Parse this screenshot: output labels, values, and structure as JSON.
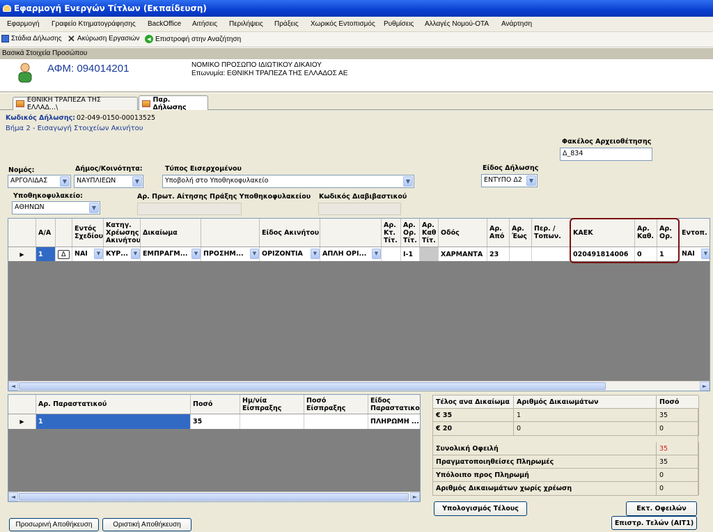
{
  "window": {
    "title": "Εφαρμογή Ενεργών Τίτλων (Εκπαίδευση)"
  },
  "menu": [
    "Εφαρμογή",
    "Γραφείο Κτηματογράφησης",
    "BackOffice",
    "Αιτήσεις",
    "Περιλήψεις",
    "Πράξεις",
    "Χωρικός Εντοπισμός",
    "Ρυθμίσεις",
    "Αλλαγές Νομού-ΟΤΑ",
    "Ανάρτηση"
  ],
  "toolbar": {
    "stages": "Στάδια Δήλωσης",
    "cancel": "Ακύρωση Εργασιών",
    "back": "Επιστροφή στην Αναζήτηση"
  },
  "section_header": "Βασικά Στοιχεία Προσώπου",
  "person": {
    "afm": "ΑΦΜ: 094014201",
    "type": "ΝΟΜΙΚΟ ΠΡΟΣΩΠΟ ΙΔΙΩΤΙΚΟΥ ΔΙΚΑΙΟΥ",
    "name": "Επωνυμία: ΕΘΝΙΚΗ ΤΡΑΠΕΖΑ ΤΗΣ ΕΛΛΑΔΟΣ ΑΕ"
  },
  "tabs": [
    "ΕΘΝΙΚΗ ΤΡΑΠΕΖΑ ΤΗΣ ΕΛΛΑΔ...\\",
    "Παρ. Δήλωσης"
  ],
  "form": {
    "code_label": "Κωδικός Δήλωσης:",
    "code_value": "02-049-0150-00013525",
    "step": "Βήμα 2 - Εισαγωγή Στοιχείων Ακινήτου",
    "folder_label": "Φακέλος Αρχειοθέτησης",
    "folder_value": "Δ_834",
    "nomos_label": "Νομός:",
    "nomos_value": "ΑΡΓΟΛΙΔΑΣ",
    "dimos_label": "Δήμος/Κοινότητα:",
    "dimos_value": "ΝΑΥΠΛΙΕΩΝ",
    "incoming_label": "Τύπος Εισερχομένου",
    "incoming_value": "Υποβολή στο Υποθηκοφυλακείο",
    "decl_type_label": "Είδος Δήλωσης",
    "decl_type_value": "ΕΝΤΥΠΟ Δ2",
    "ypoth_label": "Υποθηκοφυλακείο:",
    "ypoth_value": "ΑΘΗΝΩΝ",
    "protocol_label": "Αρ. Πρωτ. Αίτησης Πράξης Υποθηκοφυλακείου",
    "pass_label": "Κωδικός Διαβιβαστικού"
  },
  "main_grid": {
    "headers": [
      "Α/Α",
      "Εντός Σχεδίου",
      "Κατηγ. Χρέωσης Ακινήτου",
      "Δικαίωμα",
      "Είδος Ακινήτου",
      "Αρ. Κτ. Τίτ.",
      "Αρ. Ορ. Τίτ.",
      "Αρ. Καθ Τίτ.",
      "Οδός",
      "Αρ. Από",
      "Αρ. Έως",
      "Περ. / Τοπων.",
      "ΚΑΕΚ",
      "Αρ. Καθ.",
      "Αρ. Ορ.",
      "Εντοπ."
    ],
    "row": {
      "aa": "1",
      "delta": "Δ",
      "entos": "ΝΑΙ",
      "katigoria": "ΚΥΡ...",
      "dikaioma": "ΕΜΠΡΑΓΜ...",
      "prosim": "ΠΡΟΣΗΜ...",
      "eidos": "ΟΡΙΖΟΝΤΙΑ",
      "apli": "ΑΠΛΗ ΟΡΙ...",
      "or_tit": "I-1",
      "odos": "ΧΑΡΜΑΝΤΑ",
      "ar_apo": "23",
      "kaek": "020491814006",
      "ar_kath": "0",
      "ar_or": "1",
      "entop": "ΝΑΙ"
    }
  },
  "payments_grid": {
    "headers": [
      "Αρ. Παραστατικού",
      "Ποσό",
      "Ημ/νία Είσπραξης",
      "Ποσό Είσπραξης",
      "Είδος Παραστατικού"
    ],
    "row": {
      "ar": "1",
      "poso": "35",
      "eidos": "ΠΛΗΡΩΜΗ ..."
    }
  },
  "fees": {
    "headers": [
      "Τέλος ανα Δικαίωμα",
      "Αριθμός Δικαιωμάτων",
      "Ποσό"
    ],
    "rows": [
      {
        "fee": "€ 35",
        "count": "1",
        "amount": "35"
      },
      {
        "fee": "€ 20",
        "count": "0",
        "amount": "0"
      }
    ],
    "summary": [
      {
        "label": "Συνολική Οφειλή",
        "value": "35"
      },
      {
        "label": "Πραγματοποιηθείσες Πληρωμές",
        "value": "35"
      },
      {
        "label": "Υπόλοιπο προς Πληρωμή",
        "value": "0"
      },
      {
        "label": "Αριθμός Δικαιωμάτων χωρίς χρέωση",
        "value": "0"
      }
    ]
  },
  "buttons": {
    "calc": "Υπολογισμός Τέλους",
    "print_debts": "Εκτ. Οφειλών",
    "return_fees": "Επιστρ. Τελών (ΑΙΤ1)",
    "temp_save": "Προσωρινή Αποθήκευση",
    "final_save": "Οριστική Αποθήκευση"
  },
  "colors": {
    "title_bar": "#0a3fd0",
    "highlight_box": "#7a1010",
    "total_debt": "#d42020",
    "selected_row": "#316ac5"
  }
}
